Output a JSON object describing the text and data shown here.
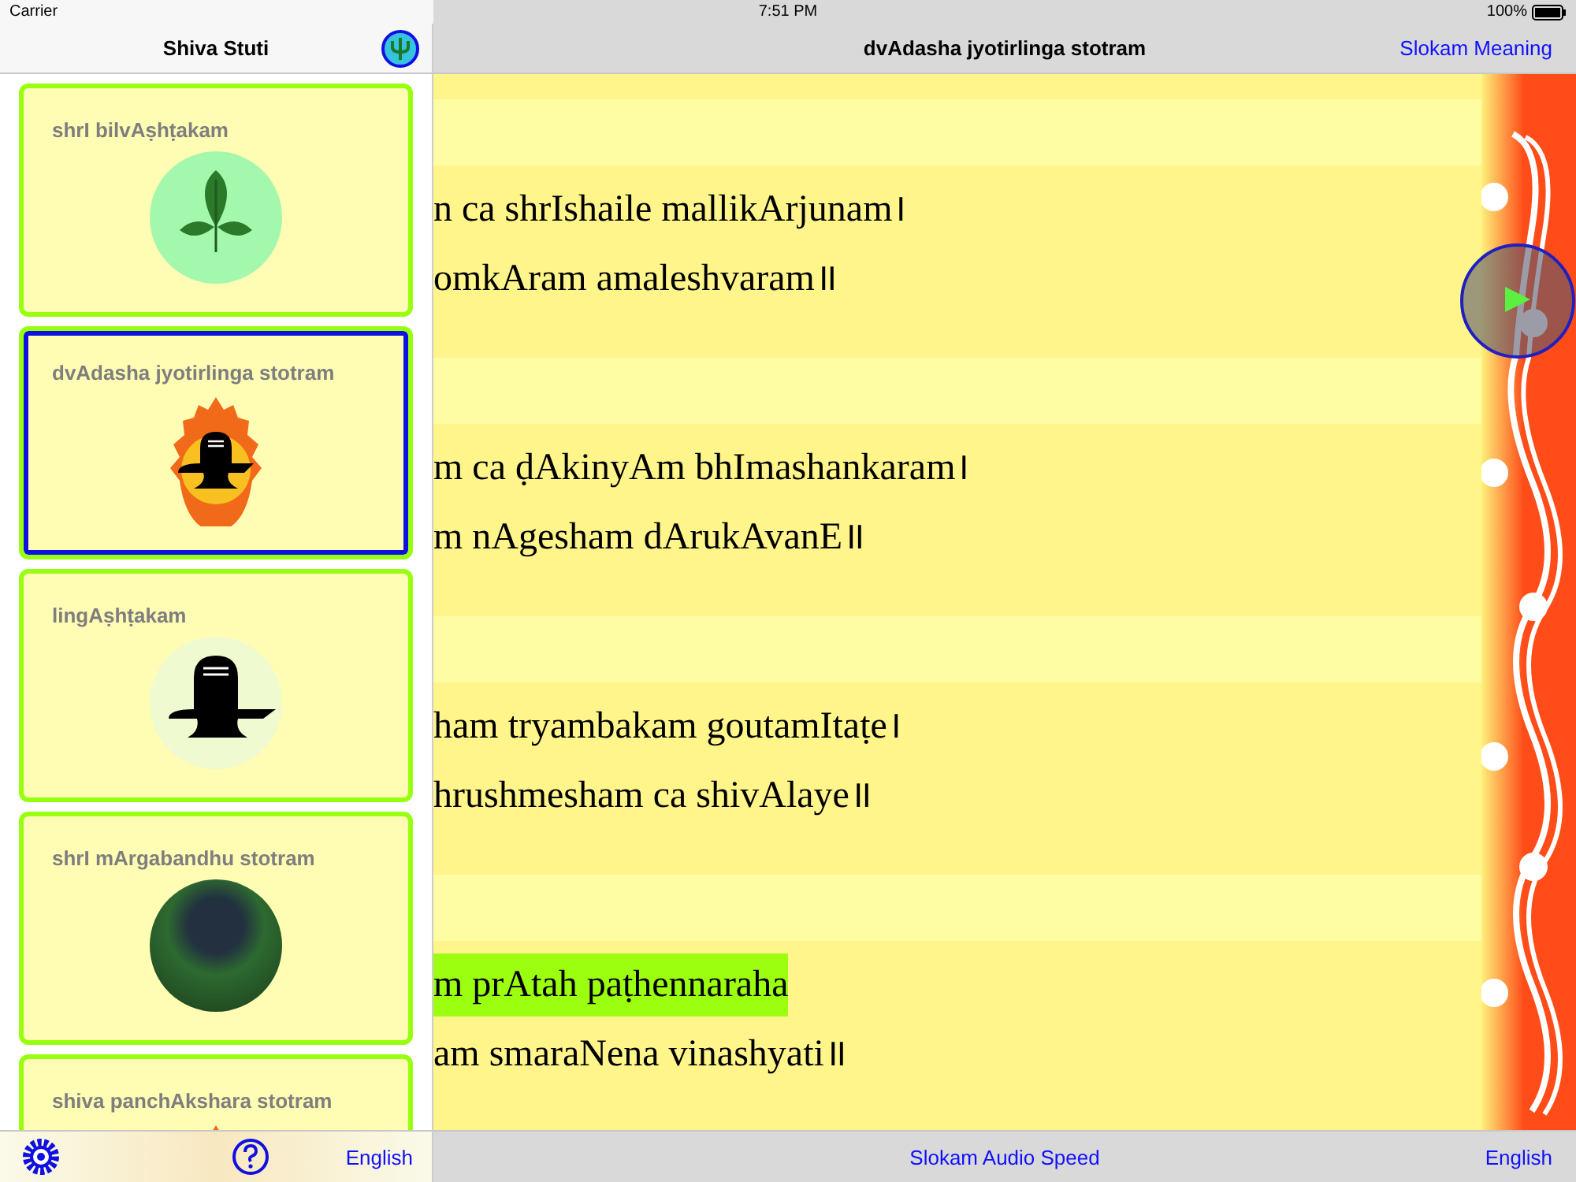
{
  "status_bar": {
    "carrier": "Carrier",
    "time": "7:51 PM",
    "battery": "100%"
  },
  "sidebar": {
    "title": "Shiva Stuti",
    "items": [
      {
        "title": "shrI bilvAṣhṭakam",
        "kind": "leaf",
        "selected": false
      },
      {
        "title": "dvAdasha jyotirlinga stotram",
        "kind": "flame",
        "selected": true
      },
      {
        "title": "lingAṣhṭakam",
        "kind": "lingam",
        "selected": false
      },
      {
        "title": "shrI mArgabandhu stotram",
        "kind": "photo",
        "selected": false
      },
      {
        "title": "shiva panchAkshara stotram",
        "kind": "flame",
        "selected": false
      }
    ],
    "toolbar": {
      "language": "English"
    }
  },
  "main": {
    "title": "dvAdasha jyotirlinga stotram",
    "meaning_button": "Slokam Meaning",
    "verses": [
      {
        "lines": [
          {
            "text": "n ca shrIshaile mallikArjunam।",
            "highlighted": false
          },
          {
            "text": "omkAram amaleshvaram॥",
            "highlighted": false
          }
        ]
      },
      {
        "lines": [
          {
            "text": "m ca ḍAkinyAm bhImashankaram।",
            "highlighted": false
          },
          {
            "text": "m nAgesham dArukAvanE॥",
            "highlighted": false
          }
        ]
      },
      {
        "lines": [
          {
            "text": "ham tryambakam goutamItaṭe।",
            "highlighted": false
          },
          {
            "text": "hrushmesham ca shivAlaye॥",
            "highlighted": false
          }
        ]
      },
      {
        "lines": [
          {
            "text": "m prAtah paṭhennaraha",
            "highlighted": true
          },
          {
            "text": "am smaraNena vinashyati॥",
            "highlighted": false
          }
        ]
      }
    ],
    "toolbar": {
      "speed_button": "Slokam Audio Speed",
      "language": "English"
    }
  }
}
